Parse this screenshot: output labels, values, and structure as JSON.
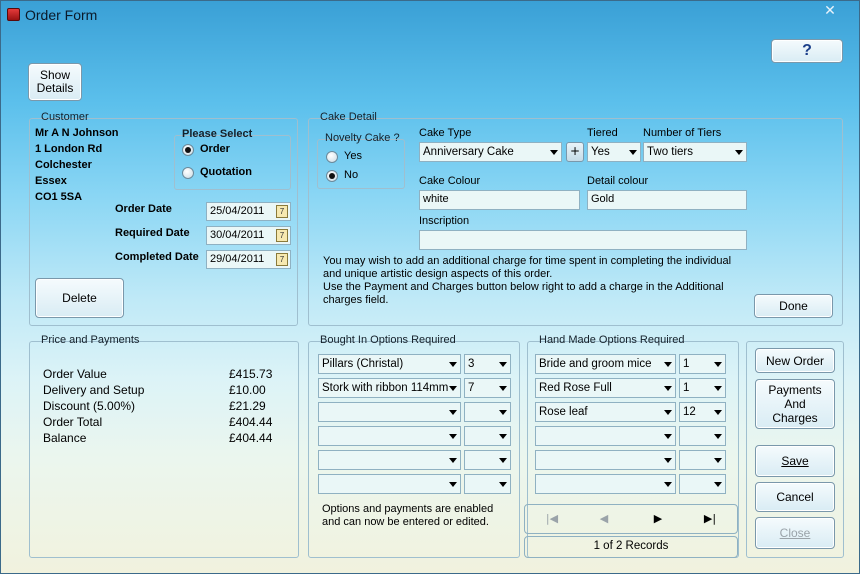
{
  "window": {
    "title": "Order Form",
    "close_glyph": "✕"
  },
  "toolbar": {
    "help_label": "?",
    "show_details_label": "Show\nDetails"
  },
  "customer": {
    "group_title": "Customer",
    "name": "Mr A N Johnson",
    "address1": "1 London Rd",
    "address2": "Colchester",
    "address3": "Essex",
    "postcode": "CO1 5SA",
    "select_title": "Please Select",
    "option_order": "Order",
    "option_quotation": "Quotation",
    "selected": "Order",
    "order_date_label": "Order Date",
    "order_date": "25/04/2011",
    "required_date_label": "Required Date",
    "required_date": "30/04/2011",
    "completed_date_label": "Completed Date",
    "completed_date": "29/04/2011",
    "delete_label": "Delete"
  },
  "cake": {
    "group_title": "Cake Detail",
    "novelty_title": "Novelty Cake ?",
    "novelty_yes": "Yes",
    "novelty_no": "No",
    "novelty_selected": "No",
    "type_label": "Cake Type",
    "type_value": "Anniversary Cake",
    "plus_label": "+",
    "tiered_label": "Tiered",
    "tiered_value": "Yes",
    "tiers_label": "Number of Tiers",
    "tiers_value": "Two tiers",
    "colour_label": "Cake Colour",
    "colour_value": "white",
    "detail_colour_label": "Detail colour",
    "detail_colour_value": "Gold",
    "inscription_label": "Inscription",
    "inscription_value": "",
    "note": "You may wish to add an additional charge for time spent in completing the individual and unique artistic design aspects of this order.\nUse the Payment and Charges button below right to add a charge in the Additional charges field.",
    "done_label": "Done"
  },
  "payments": {
    "group_title": "Price and Payments",
    "rows": [
      {
        "label": "Order Value",
        "value": "£415.73"
      },
      {
        "label": "Delivery and Setup",
        "value": "£10.00"
      },
      {
        "label": "Discount (5.00%)",
        "value": "£21.29"
      },
      {
        "label": "Order Total",
        "value": "£404.44"
      },
      {
        "label": "Balance",
        "value": "£404.44"
      }
    ]
  },
  "bought_in": {
    "group_title": "Bought In Options Required",
    "rows": [
      {
        "item": "Pillars (Christal)",
        "qty": "3"
      },
      {
        "item": "Stork with ribbon 114mm",
        "qty": "7"
      },
      {
        "item": "",
        "qty": ""
      },
      {
        "item": "",
        "qty": ""
      },
      {
        "item": "",
        "qty": ""
      },
      {
        "item": "",
        "qty": ""
      }
    ],
    "note": "Options and payments are enabled and can now be entered or edited."
  },
  "hand_made": {
    "group_title": "Hand Made Options Required",
    "rows": [
      {
        "item": "Bride and groom mice",
        "qty": "1"
      },
      {
        "item": "Red Rose Full",
        "qty": "1"
      },
      {
        "item": "Rose leaf",
        "qty": "12"
      },
      {
        "item": "",
        "qty": ""
      },
      {
        "item": "",
        "qty": ""
      },
      {
        "item": "",
        "qty": ""
      }
    ],
    "nav_first": "|◀",
    "nav_prev": "◀",
    "nav_next": "▶",
    "nav_last": "▶|",
    "records": "1 of 2 Records"
  },
  "actions": {
    "new_order": "New Order",
    "payments_charges": "Payments And Charges",
    "save": "Save",
    "cancel": "Cancel",
    "close": "Close"
  }
}
